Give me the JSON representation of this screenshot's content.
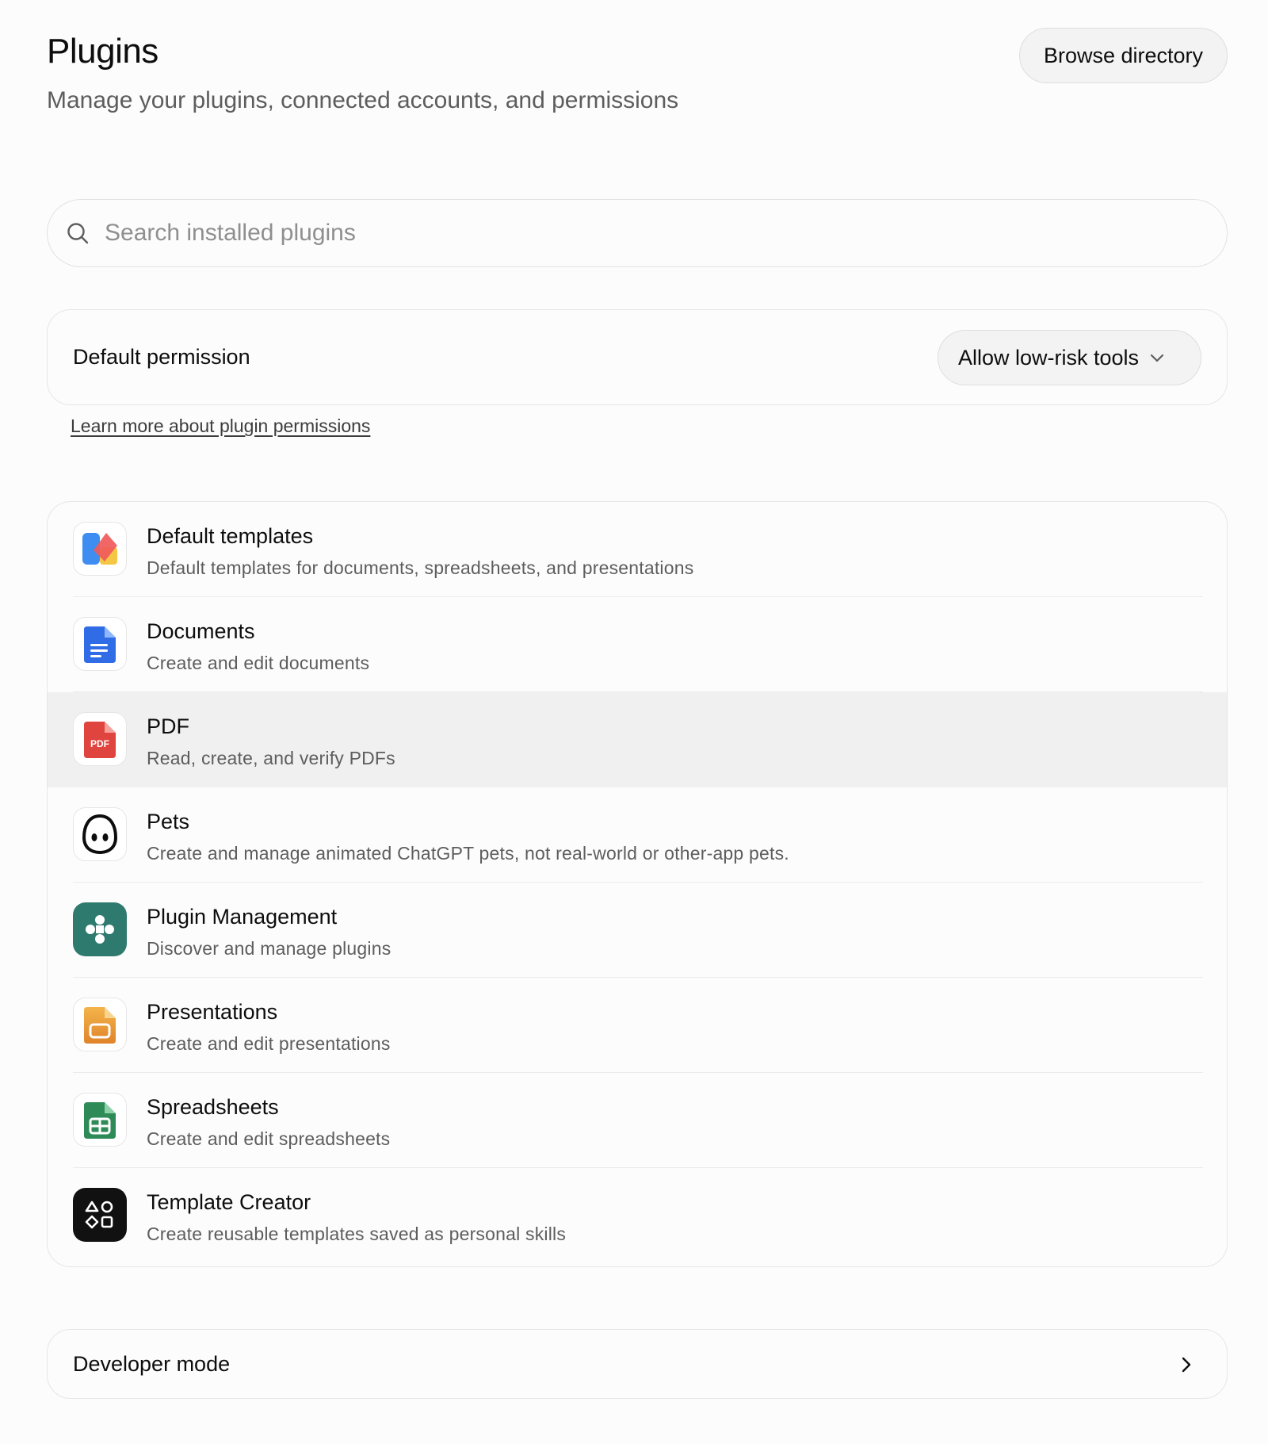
{
  "header": {
    "title": "Plugins",
    "subtitle": "Manage your plugins, connected accounts, and permissions",
    "browse_label": "Browse directory"
  },
  "search": {
    "placeholder": "Search installed plugins",
    "value": "",
    "icon": "search-icon"
  },
  "permission": {
    "label": "Default permission",
    "selected": "Allow low-risk tools",
    "learn_more": "Learn more about plugin permissions"
  },
  "plugins": [
    {
      "name": "Default templates",
      "description": "Default templates for documents, spreadsheets, and presentations",
      "icon": "default-templates-icon"
    },
    {
      "name": "Documents",
      "description": "Create and edit documents",
      "icon": "documents-icon"
    },
    {
      "name": "PDF",
      "description": "Read, create, and verify PDFs",
      "icon": "pdf-icon",
      "icon_text": "PDF"
    },
    {
      "name": "Pets",
      "description": "Create and manage animated ChatGPT pets, not real-world or other-app pets.",
      "icon": "pets-icon"
    },
    {
      "name": "Plugin Management",
      "description": "Discover and manage plugins",
      "icon": "plugin-management-icon"
    },
    {
      "name": "Presentations",
      "description": "Create and edit presentations",
      "icon": "presentations-icon"
    },
    {
      "name": "Spreadsheets",
      "description": "Create and edit spreadsheets",
      "icon": "spreadsheets-icon"
    },
    {
      "name": "Template Creator",
      "description": "Create reusable templates saved as personal skills",
      "icon": "template-creator-icon"
    }
  ],
  "developer": {
    "label": "Developer mode"
  },
  "colors": {
    "highlight_row": "#f0f0f0",
    "pdf_red": "#e0443e",
    "docs_blue": "#2f6ce5",
    "plugin_mgmt_green": "#2f7a6e",
    "presentations_orange": "#e9a23b",
    "spreadsheets_green": "#2e8b57"
  }
}
